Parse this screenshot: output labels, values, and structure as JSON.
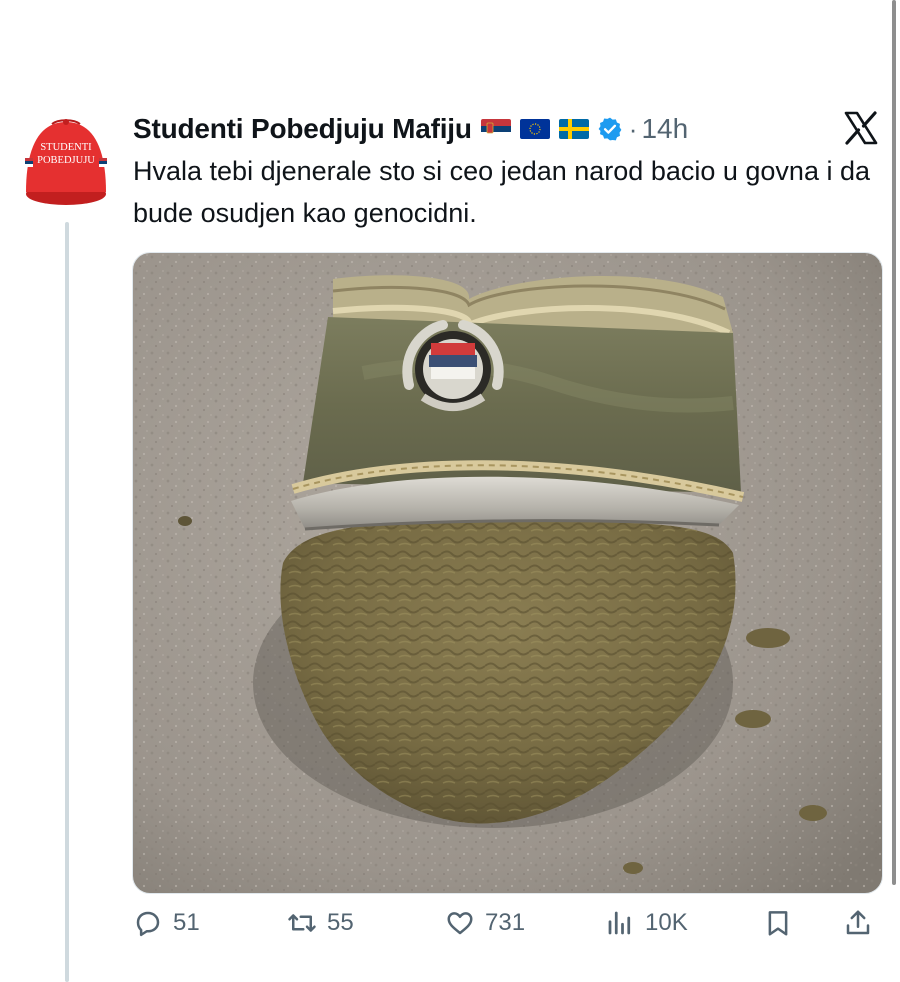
{
  "tweet": {
    "author_name": "Studenti Pobedjuju Mafiju",
    "time": "14h",
    "separator": "·",
    "text": "Hvala tebi djenerale sto si ceo jedan narod bacio u govna i da bude osudjen kao genocidni.",
    "avatar_caption_line1": "STUDENTI",
    "avatar_caption_line2": "POBEDJUJU",
    "flags": [
      "serbia-flag",
      "eu-flag",
      "sweden-flag"
    ],
    "verified_icon": "verified-badge-icon",
    "platform_icon": "x-logo-icon"
  },
  "actions": {
    "replies": "51",
    "reposts": "55",
    "likes": "731",
    "views": "10K",
    "bookmark_icon": "bookmark-icon",
    "share_icon": "share-icon"
  },
  "colors": {
    "secondary_text": "#536471",
    "verified_blue": "#1d9bf0",
    "avatar_red": "#e32b2b"
  }
}
